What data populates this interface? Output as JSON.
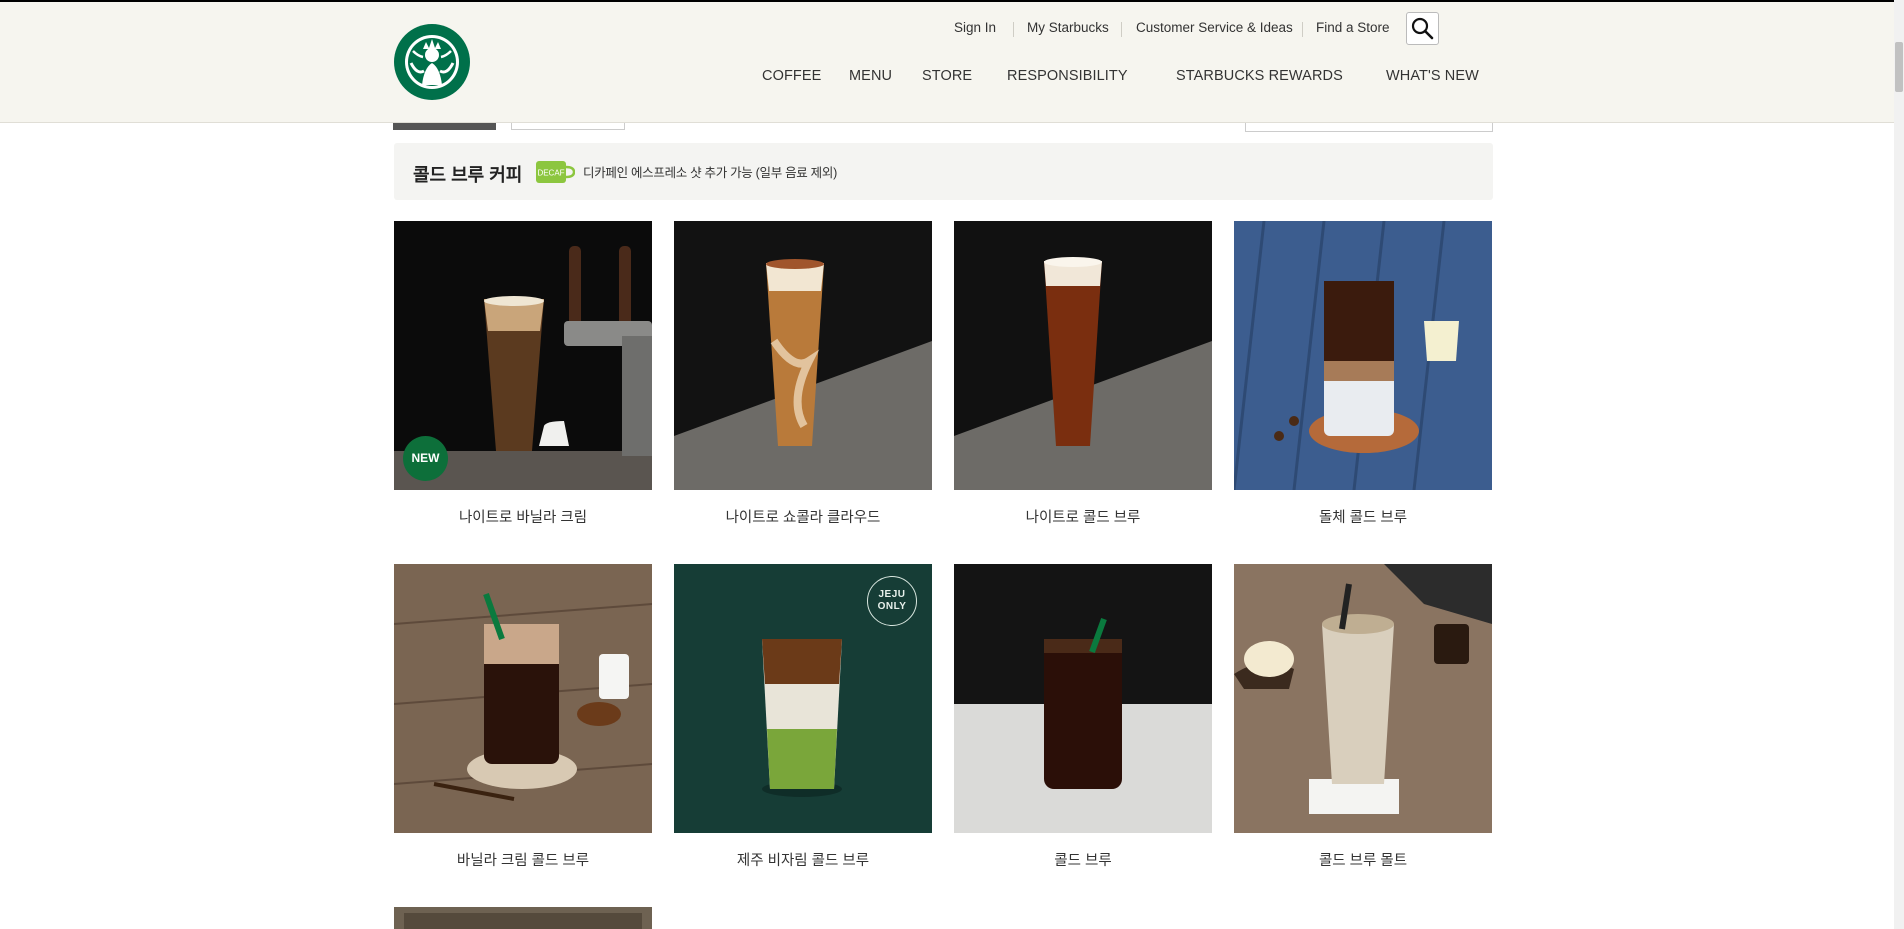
{
  "header": {
    "util_links": [
      "Sign In",
      "My Starbucks",
      "Customer Service & Ideas",
      "Find a Store"
    ],
    "gnb": [
      "COFFEE",
      "MENU",
      "STORE",
      "RESPONSIBILITY",
      "STARBUCKS REWARDS",
      "WHAT'S NEW"
    ]
  },
  "category": {
    "title": "콜드 브루 커피",
    "decaf_badge": "DECAF",
    "note": "디카페인 에스프레소 샷 추가 가능 (일부 음료 제외)"
  },
  "products": [
    {
      "name": "나이트로 바닐라 크림",
      "badge": "NEW"
    },
    {
      "name": "나이트로 쇼콜라 클라우드"
    },
    {
      "name": "나이트로 콜드 브루"
    },
    {
      "name": "돌체 콜드 브루"
    },
    {
      "name": "바닐라 크림 콜드 브루"
    },
    {
      "name": "제주 비자림 콜드 브루",
      "badge_lines": [
        "JEJU",
        "ONLY"
      ]
    },
    {
      "name": "콜드 브루"
    },
    {
      "name": "콜드 브루 몰트"
    }
  ],
  "colors": {
    "brand_green": "#00704a",
    "header_bg": "#f6f5ef",
    "new_badge": "#0d6f3a",
    "jeju_bg": "#163d36"
  }
}
